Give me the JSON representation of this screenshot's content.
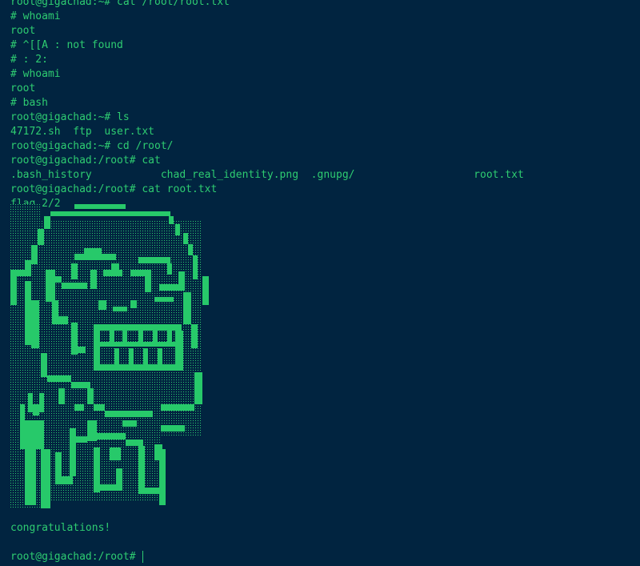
{
  "colors": {
    "background": "#012440",
    "text": "#2ecc71",
    "art_fill": "#27c96a",
    "art_shade": "#1a6b4c"
  },
  "terminal": {
    "lines": [
      "root@gigachad:~# cat /root/root.txt",
      "# whoami",
      "root",
      "# ^[[A : not found",
      "# : 2:",
      "# whoami",
      "root",
      "# bash",
      "root@gigachad:~# ls",
      "47172.sh  ftp  user.txt",
      "root@gigachad:~# cd /root/",
      "root@gigachad:/root# cat",
      ".bash_history           chad_real_identity.png  .gnupg/                   root.txt",
      "root@gigachad:/root# cat root.txt",
      "flag 2/2"
    ],
    "congrats": "congratulations!",
    "final_prompt": "root@gigachad:/root# "
  }
}
